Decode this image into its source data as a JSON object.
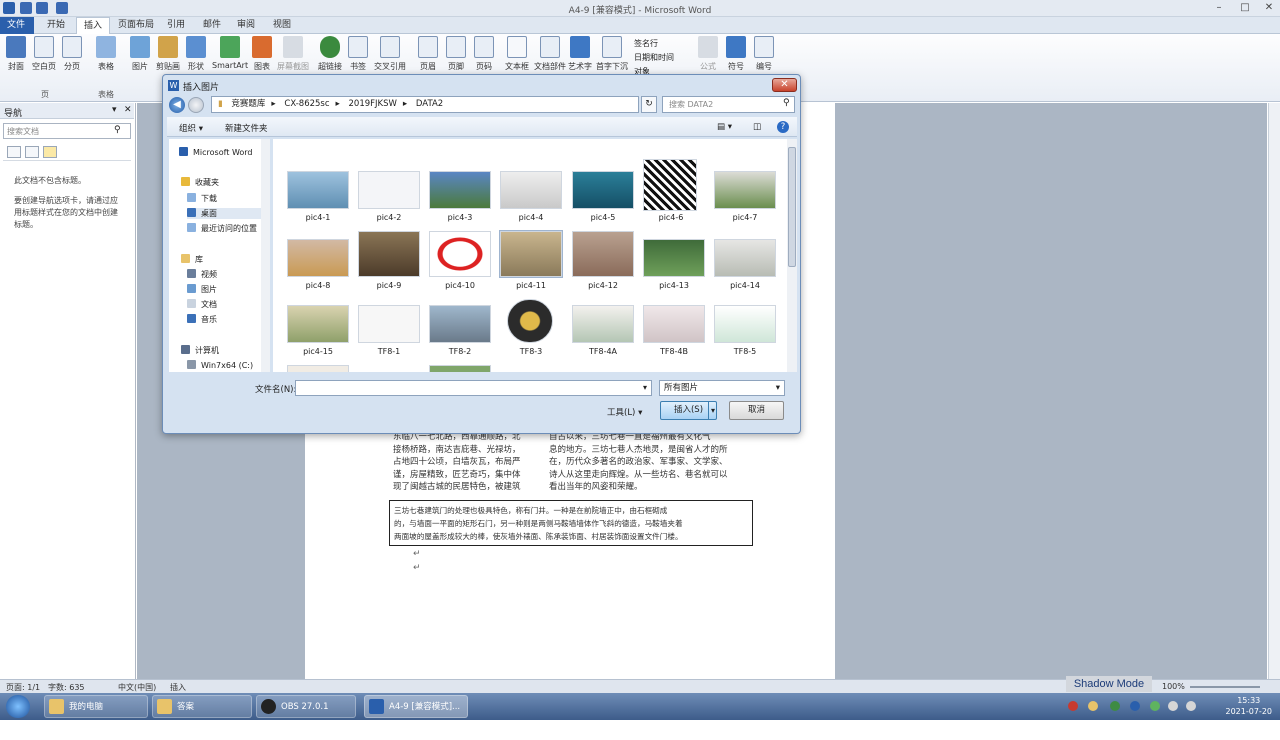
{
  "window": {
    "title": "A4-9 [兼容模式] - Microsoft Word",
    "colors": {
      "file_tab": "#2a5fac",
      "ribbon": "#e9eef5",
      "doc_bg": "#abb6c4",
      "taskbar": "#4d6c9a"
    }
  },
  "tabs": [
    "文件",
    "开始",
    "插入",
    "页面布局",
    "引用",
    "邮件",
    "审阅",
    "视图"
  ],
  "ribbon": {
    "buttons": [
      "封面",
      "空白页",
      "分页",
      "表格",
      "图片",
      "剪贴画",
      "形状",
      "SmartArt",
      "图表",
      "屏幕截图",
      "超链接",
      "书签",
      "交叉引用",
      "页眉",
      "页脚",
      "页码",
      "文本框",
      "文档部件",
      "艺术字",
      "首字下沉",
      "公式",
      "符号",
      "编号"
    ],
    "small_items": [
      "签名行",
      "日期和时间",
      "对象"
    ],
    "groups": [
      "页",
      "表格"
    ]
  },
  "nav_pane": {
    "title": "导航",
    "search_placeholder": "搜索文档",
    "message_line1": "此文档不包含标题。",
    "message_line2": "要创建导航选项卡，请通过应用标题样式在您的文档中创建标题。"
  },
  "document": {
    "lines": [
      "东临八一七北路，西靠通顺路，北",
      "接杨桥路，南达吉庇巷、光禄坊，",
      "占地四十公顷，白墙灰瓦，布局严",
      "谨，房屋精致，匠艺奇巧，集中体",
      "现了闽越古城的民居特色，被建筑"
    ],
    "right_lines": [
      "自古以来，三坊七巷一直是福州最有文化气",
      "息的地方。三坊七巷人杰地灵，是闽省人才的所",
      "在，历代众多著名的政治家、军事家、文学家、",
      "诗人从这里走向辉煌。从一些坊名、巷名就可以",
      "看出当年的风姿和荣耀。"
    ],
    "box_lines": [
      "三坊七巷建筑门的处理也极具特色，称有门井。一种是在前院墙正中，由石框砌成",
      "的，与墙面一平面的矩形石门，另一种则是两侧马鞍墙墙体作飞斜的德造，马鞍墙夹着",
      "两面坡的屋盖形成较大的棒，使灰墙外裱面、陈承装饰面、村居装饰面设置文件门楼。"
    ]
  },
  "status_bar": {
    "page": "页面: 1/1",
    "words": "字数: 635",
    "language": "中文(中国)",
    "mode": "插入",
    "zoom": "100%"
  },
  "shadow_mode": "Shadow Mode",
  "taskbar": {
    "items": [
      "我的电脑",
      "答案",
      "OBS 27.0.1 (64-...",
      "A4-9 [兼容模式]..."
    ],
    "time": "15:33",
    "date": "2021-07-20"
  },
  "dialog": {
    "title": "插入图片",
    "breadcrumb": [
      "竞赛题库",
      "CX-8625sc",
      "2019FJKSW",
      "DATA2"
    ],
    "search_placeholder": "搜索 DATA2",
    "toolbar": {
      "organize": "组织 ▾",
      "new_folder": "新建文件夹"
    },
    "nav": {
      "word": "Microsoft Word",
      "favorites": "收藏夹",
      "downloads": "下载",
      "desktop": "桌面",
      "recent": "最近访问的位置",
      "libraries": "库",
      "videos": "视频",
      "pictures": "图片",
      "documents": "文档",
      "music": "音乐",
      "computer": "计算机",
      "drive": "Win7x64 (C:)"
    },
    "files": [
      "pic4-1",
      "pic4-2",
      "pic4-3",
      "pic4-4",
      "pic4-5",
      "pic4-6",
      "pic4-7",
      "pic4-8",
      "pic4-9",
      "pic4-10",
      "pic4-11",
      "pic4-12",
      "pic4-13",
      "pic4-14",
      "pic4-15",
      "TF8-1",
      "TF8-2",
      "TF8-3",
      "TF8-4A",
      "TF8-4B",
      "TF8-5"
    ],
    "filename_label": "文件名(N):",
    "filename_value": "",
    "filetype": "所有图片",
    "tools": "工具(L)",
    "insert": "插入(S)",
    "cancel": "取消"
  }
}
